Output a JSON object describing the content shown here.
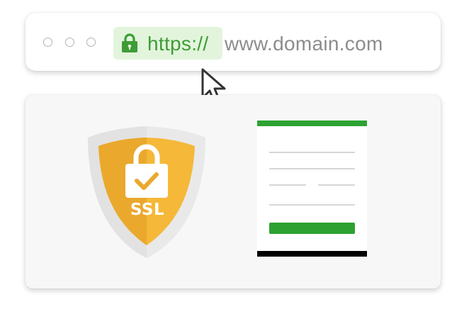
{
  "browser": {
    "window_controls": [
      "circle",
      "circle",
      "circle"
    ],
    "address_bar": {
      "scheme": "https://",
      "domain": "www.domain.com",
      "secure_icon": "lock-icon"
    },
    "pointer_icon": "cursor-arrow-icon"
  },
  "page": {
    "badge": {
      "label": "SSL",
      "icon": "padlock-check-icon",
      "colors": {
        "shield_outer": "#e9e9e9",
        "shield_inner": "#f5b838",
        "shield_inner_shade": "#eaa82d"
      }
    },
    "form": {
      "field_line_count": 5,
      "submit_button_label": ""
    }
  },
  "colors": {
    "secure_green": "#3d9c36",
    "secure_bg": "#e2f5dc",
    "domain_gray": "#8c8c8c",
    "form_accent": "#2da233"
  }
}
